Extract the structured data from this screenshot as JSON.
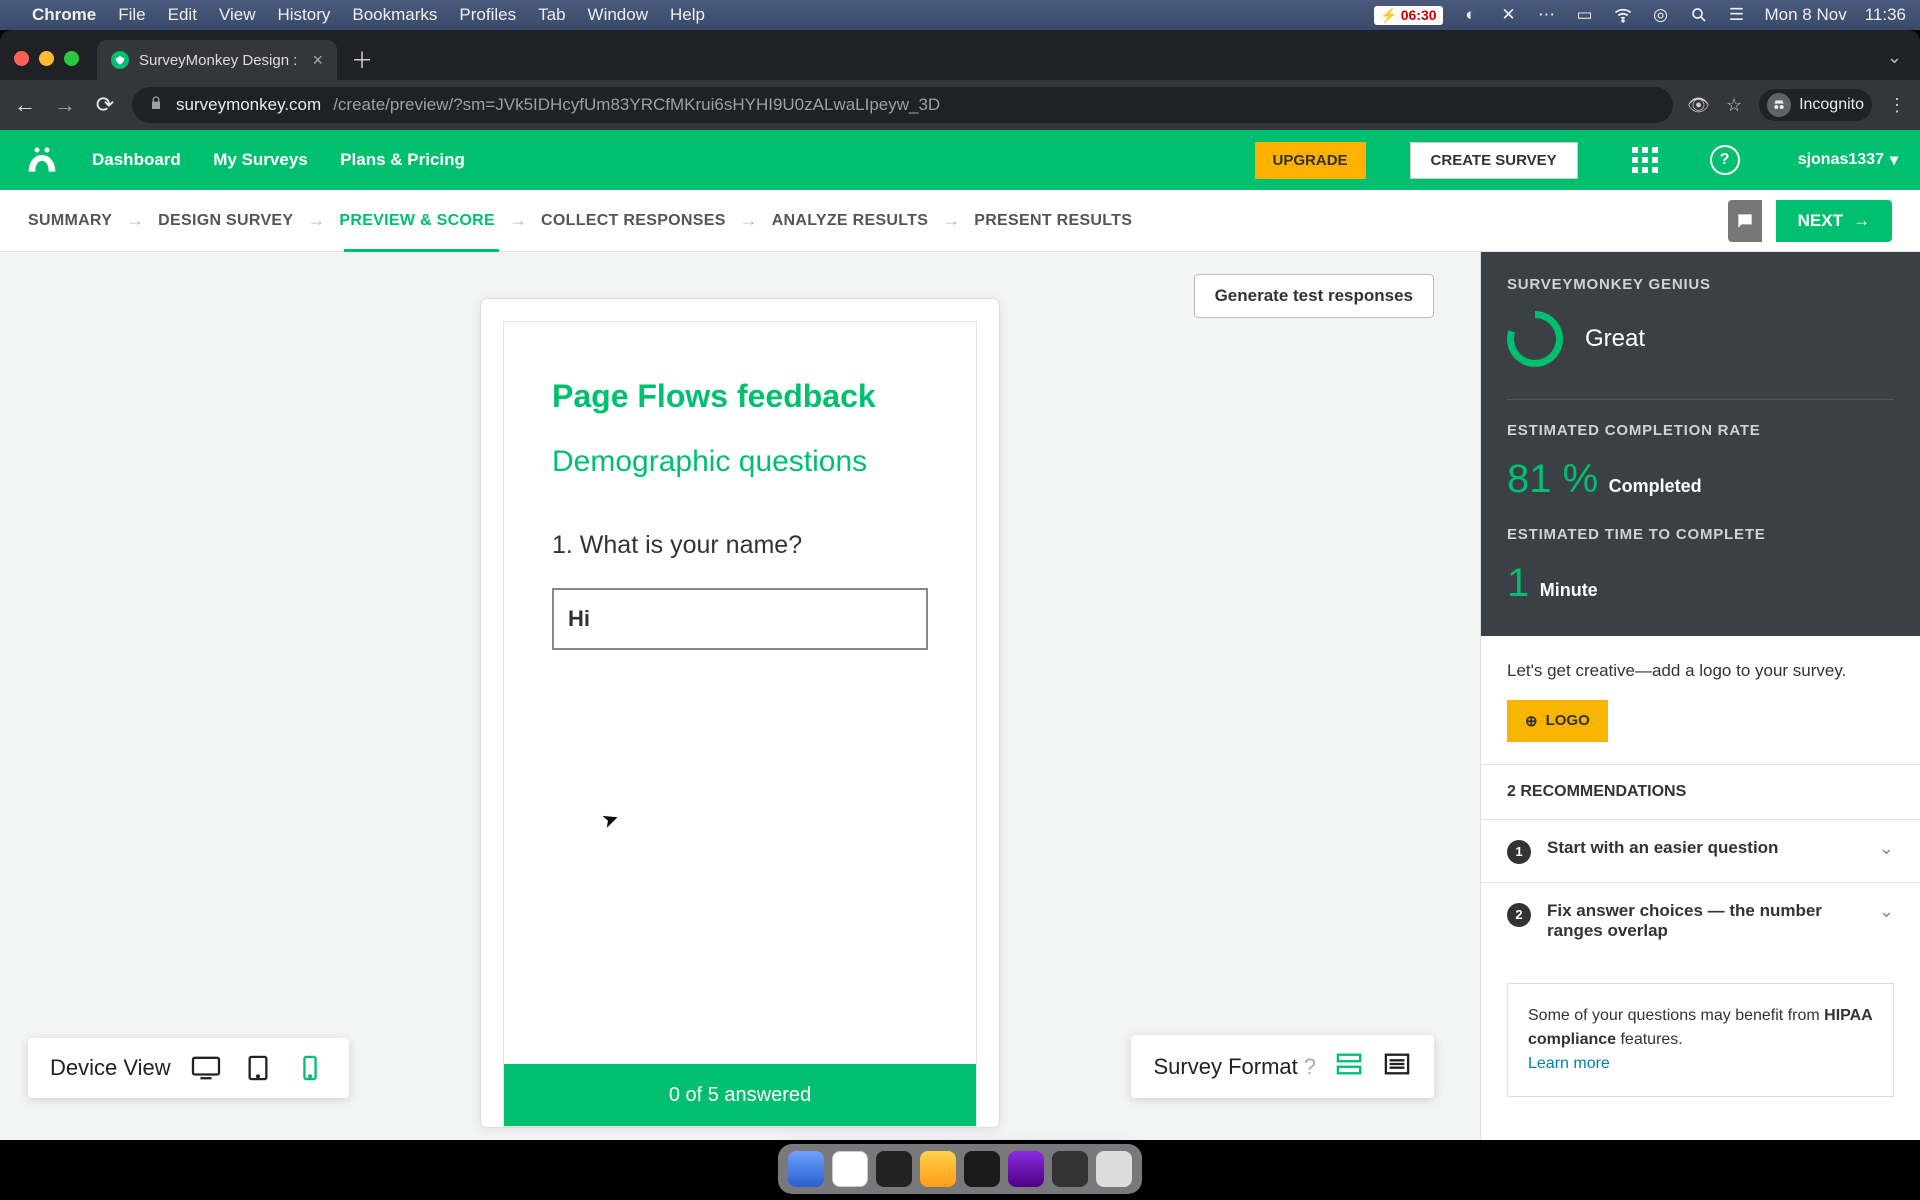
{
  "menubar": {
    "app": "Chrome",
    "items": [
      "File",
      "Edit",
      "View",
      "History",
      "Bookmarks",
      "Profiles",
      "Tab",
      "Window",
      "Help"
    ],
    "battery": "06:30",
    "date": "Mon 8 Nov",
    "time": "11:36"
  },
  "browser": {
    "tab_title": "SurveyMonkey Design :",
    "url_host": "surveymonkey.com",
    "url_path": "/create/preview/?sm=JVk5IDHcyfUm83YRCfMKrui6sHYHI9U0zALwaLIpeyw_3D",
    "incognito": "Incognito"
  },
  "header": {
    "nav": [
      "Dashboard",
      "My Surveys",
      "Plans & Pricing"
    ],
    "upgrade": "UPGRADE",
    "create": "CREATE SURVEY",
    "user": "sjonas1337"
  },
  "steps": {
    "items": [
      "SUMMARY",
      "DESIGN SURVEY",
      "PREVIEW & SCORE",
      "COLLECT RESPONSES",
      "ANALYZE RESULTS",
      "PRESENT RESULTS"
    ],
    "active_index": 2,
    "next": "NEXT"
  },
  "canvas": {
    "generate": "Generate test responses",
    "survey_title": "Page Flows feedback",
    "section_title": "Demographic questions",
    "question": "1. What is your name?",
    "answer": "Hi",
    "progress": "0 of 5 answered",
    "device_view": "Device View",
    "survey_format": "Survey Format"
  },
  "genius": {
    "header": "SURVEYMONKEY GENIUS",
    "score": "Great",
    "ecr_label": "ESTIMATED COMPLETION RATE",
    "ecr_value": "81 %",
    "ecr_unit": "Completed",
    "etc_label": "ESTIMATED TIME TO COMPLETE",
    "etc_value": "1",
    "etc_unit": "Minute",
    "tip": "Let's get creative—add a logo to your survey.",
    "logo": "LOGO",
    "reco_header": "2 RECOMMENDATIONS",
    "reco1": "Start with an easier question",
    "reco2": "Fix answer choices — the number ranges overlap",
    "hipaa_a": "Some of your questions may benefit from ",
    "hipaa_b": "HIPAA compliance",
    "hipaa_c": " features.",
    "hipaa_link": "Learn more"
  }
}
